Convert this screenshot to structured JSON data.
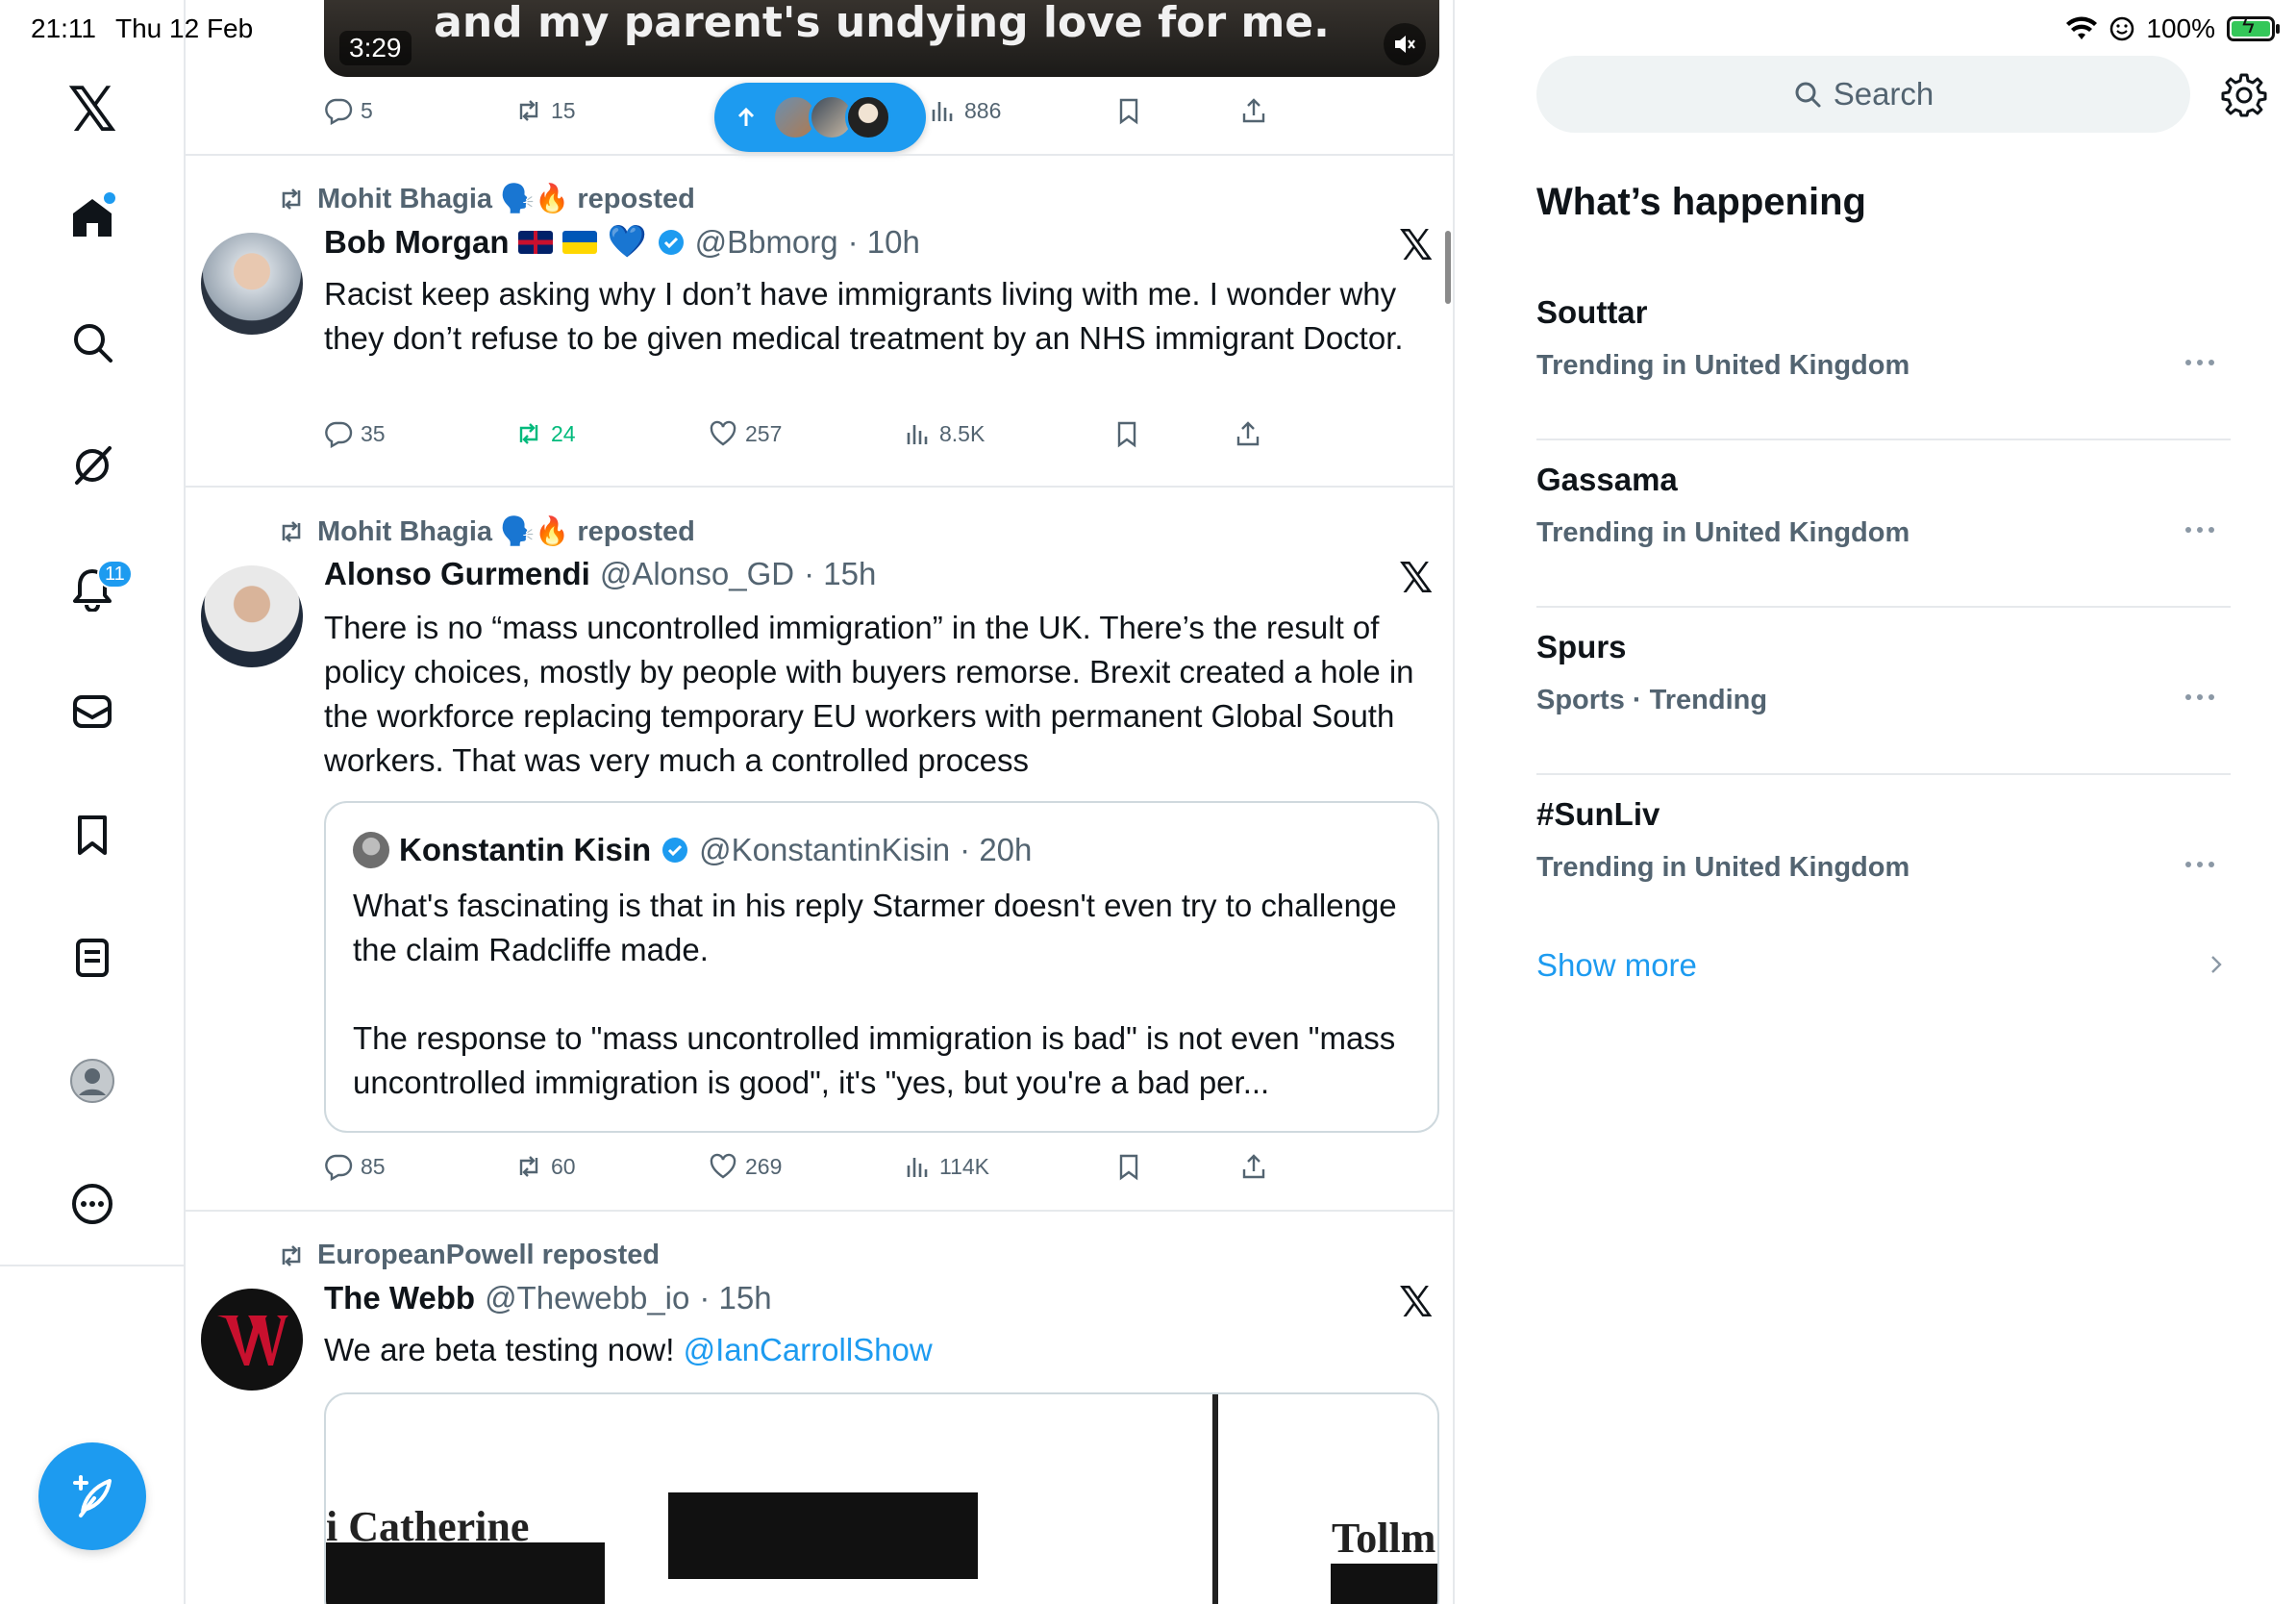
{
  "status_bar": {
    "time": "21:11",
    "date": "Thu 12 Feb",
    "battery": "100%"
  },
  "nav": {
    "logo": "𝕏",
    "notification_count": "11",
    "items": [
      "home",
      "explore",
      "grok",
      "notifications",
      "messages",
      "bookmarks",
      "lists",
      "profile",
      "more"
    ]
  },
  "video": {
    "caption": "and my parent's undying love for me.",
    "duration": "3:29"
  },
  "top_actions": {
    "replies": "5",
    "reposts": "15",
    "views": "886"
  },
  "tweets": [
    {
      "reposted_by": "Mohit Bhagia 🗣️🔥 reposted",
      "name": "Bob Morgan",
      "emoji_after_flags": "💙",
      "handle": "@Bbmorg",
      "time": "· 10h",
      "text": "Racist keep asking why I don’t have immigrants living with me. I wonder why they don’t refuse to be given medical treatment by an NHS immigrant Doctor.",
      "replies": "35",
      "reposts": "24",
      "likes": "257",
      "views": "8.5K"
    },
    {
      "reposted_by": "Mohit Bhagia 🗣️🔥 reposted",
      "name": "Alonso Gurmendi",
      "handle": "@Alonso_GD",
      "time": "· 15h",
      "text": "There is no “mass uncontrolled immigration” in the UK. There’s the result of policy choices, mostly by people with buyers remorse. Brexit created a hole in the workforce replacing temporary EU workers with permanent Global South workers. That was very much a controlled process",
      "quote": {
        "name": "Konstantin Kisin",
        "handle": "@KonstantinKisin",
        "time": "· 20h",
        "text": "What's fascinating is that in his reply Starmer doesn't even try to challenge the claim Radcliffe made.\n\nThe response to \"mass uncontrolled immigration is bad\" is not even \"mass uncontrolled immigration is good\", it's \"yes, but you're a bad per..."
      },
      "replies": "85",
      "reposts": "60",
      "likes": "269",
      "views": "114K"
    },
    {
      "reposted_by": "EuropeanPowell reposted",
      "name": "The Webb",
      "handle": "@Thewebb_io",
      "time": "· 15h",
      "text": "We are beta testing now!",
      "mention": "@IanCarrollShow",
      "media_text_1": "i Catherine",
      "media_text_2": "Tollm"
    }
  ],
  "sidebar": {
    "search_placeholder": "Search",
    "section_title": "What’s happening",
    "trends": [
      {
        "name": "Souttar",
        "context": "Trending in United Kingdom"
      },
      {
        "name": "Gassama",
        "context": "Trending in United Kingdom"
      },
      {
        "name": "Spurs",
        "context": "Sports · Trending"
      },
      {
        "name": "#SunLiv",
        "context": "Trending in United Kingdom"
      }
    ],
    "show_more": "Show more"
  },
  "colors": {
    "accent": "#1d9bf0",
    "secondary_text": "#536471",
    "repost_green": "#00ba7c",
    "divider": "#e6e9ec"
  }
}
